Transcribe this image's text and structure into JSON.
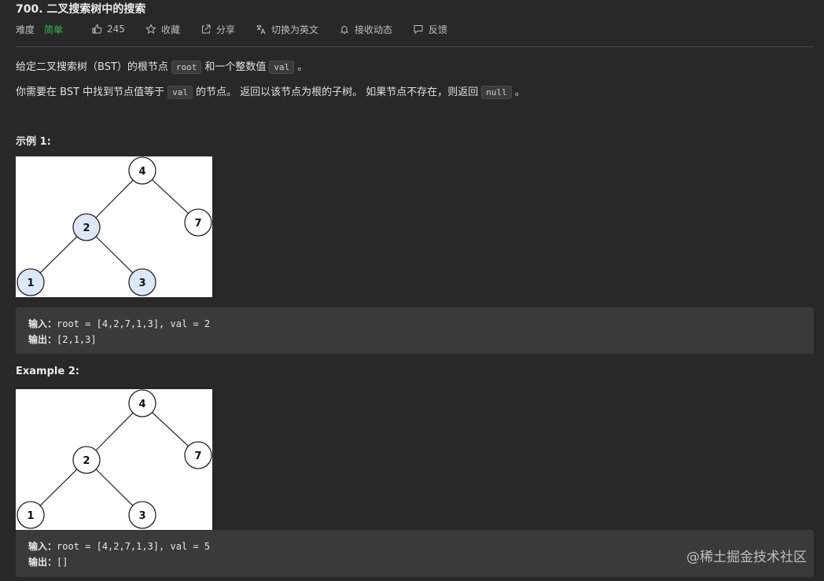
{
  "problem": {
    "title": "700. 二叉搜索树中的搜索",
    "difficulty_label": "难度",
    "difficulty": "简单",
    "likes": "245",
    "favorite_label": "收藏",
    "share_label": "分享",
    "translate_label": "切换为英文",
    "notify_label": "接收动态",
    "feedback_label": "反馈"
  },
  "description": {
    "p1_a": "给定二叉搜索树（BST）的根节点",
    "p1_code1": "root",
    "p1_b": "和一个整数值",
    "p1_code2": "val",
    "p1_c": "。",
    "p2_a": "你需要在 BST 中找到节点值等于",
    "p2_code1": "val",
    "p2_b": "的节点。 返回以该节点为根的子树。 如果节点不存在，则返回",
    "p2_code2": "null",
    "p2_c": "。"
  },
  "examples": [
    {
      "heading": "示例 1:",
      "nodes": [
        "4",
        "2",
        "7",
        "1",
        "3"
      ],
      "highlighted": [
        "2",
        "1",
        "3"
      ],
      "input_label": "输入：",
      "input_value": "root = [4,2,7,1,3], val = 2",
      "output_label": "输出：",
      "output_value": "[2,1,3]"
    },
    {
      "heading": "Example 2:",
      "nodes": [
        "4",
        "2",
        "7",
        "1",
        "3"
      ],
      "highlighted": [],
      "input_label": "输入：",
      "input_value": "root = [4,2,7,1,3], val = 5",
      "output_label": "输出：",
      "output_value": "[]"
    }
  ],
  "colors": {
    "accent_easy": "#2dbd4f",
    "node_highlight": "#dce8f8",
    "node_default": "#ffffff"
  },
  "watermark": "@稀土掘金技术社区"
}
